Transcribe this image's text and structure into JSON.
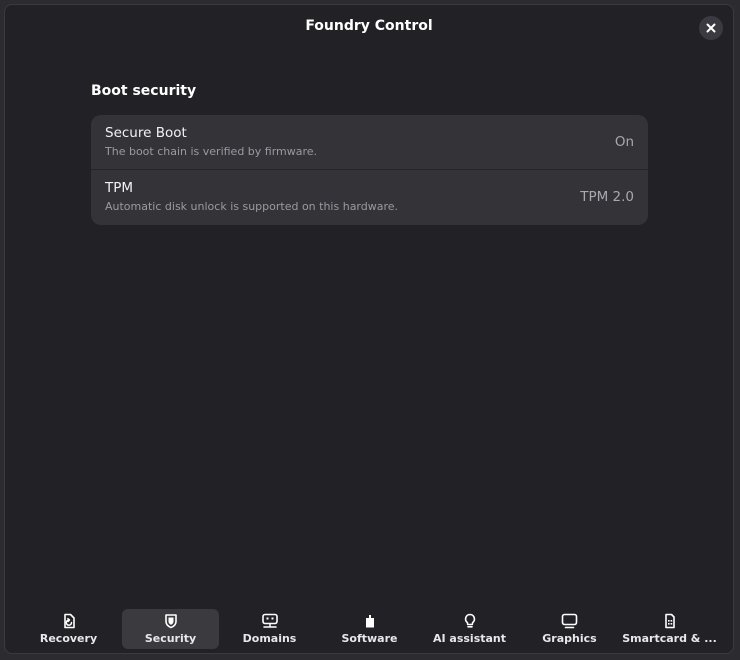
{
  "window": {
    "title": "Foundry Control"
  },
  "section": {
    "title": "Boot security"
  },
  "rows": [
    {
      "title": "Secure Boot",
      "subtitle": "The boot chain is verified by firmware.",
      "value": "On"
    },
    {
      "title": "TPM",
      "subtitle": "Automatic disk unlock is supported on this hardware.",
      "value": "TPM 2.0"
    }
  ],
  "tabs": [
    {
      "label": "Recovery",
      "icon": "recovery-icon"
    },
    {
      "label": "Security",
      "icon": "shield-icon",
      "active": true
    },
    {
      "label": "Domains",
      "icon": "domains-icon"
    },
    {
      "label": "Software",
      "icon": "software-icon"
    },
    {
      "label": "AI assistant",
      "icon": "lightbulb-icon"
    },
    {
      "label": "Graphics",
      "icon": "monitor-icon"
    },
    {
      "label": "Smartcard & ...",
      "icon": "smartcard-icon"
    }
  ],
  "colors": {
    "background": "#222226",
    "card": "#333338",
    "active_tab": "#3a3a3f"
  }
}
